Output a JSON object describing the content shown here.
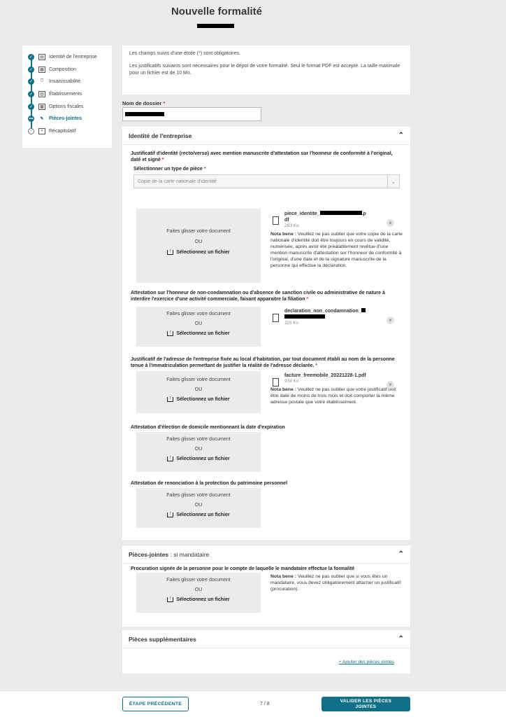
{
  "page": {
    "title": "Nouvelle formalité"
  },
  "stepper": {
    "steps": [
      {
        "label": "Identité de l'entreprise",
        "icon": "id-card-icon",
        "status": "done"
      },
      {
        "label": "Composition",
        "icon": "org-icon",
        "status": "done"
      },
      {
        "label": "Insaisissabilité",
        "icon": "shield-icon",
        "status": "done"
      },
      {
        "label": "Établissements",
        "icon": "building-icon",
        "status": "done"
      },
      {
        "label": "Options fiscales",
        "icon": "calculator-icon",
        "status": "done"
      },
      {
        "label": "Pièces-jointes",
        "icon": "paperclip-icon",
        "status": "active"
      },
      {
        "label": "Récapitulatif",
        "icon": "search-document-icon",
        "status": "todo"
      }
    ]
  },
  "info": {
    "line1_a": "Les champs suivis d'une étoile (",
    "line1_star": "*",
    "line1_b": ") sont obligatoires.",
    "line2": "Les justificatifs suivants sont nécessaires pour le dépot de votre formalité. Seul le format PDF est accepté. La taille maximale pour un fichier est de 10 Mo."
  },
  "dossier": {
    "label": "Nom de dossier",
    "star": "*"
  },
  "common": {
    "drag_text": "Faites glisser votre document",
    "or_text": "OU",
    "select_file": "Sélectionnez un fichier",
    "star": "*",
    "note_label": "Nota bene :"
  },
  "sections": {
    "identite": {
      "title": "Identité de l'entreprise",
      "field1": {
        "label": "Justificatif d'identité (recto/verso) avec mention manuscrite d'attestation sur l'honneur de conformité à l'original, daté et signé",
        "select_label": "Sélectionner un type de pièce",
        "select_value": "Copie de la carte nationale d'identité",
        "file_name_a": "piece_identite_",
        "file_name_b": ".p",
        "file_name_c": "df",
        "file_size": "283 Ko",
        "note": "Veuillez ne pas oublier que votre copie de la carte nationale d'identité doit être toujours en cours de validité, numérisée, après avoir été préalablement revêtue d'une mention manuscrite d'attestation sur l'honneur de conformité à l'original, d'une date et de la signature manuscrite de la personne qui effectue la déclaration."
      },
      "field2": {
        "label": "Attestation sur l'honneur de non-condamnation ou d'absence de sanction civile ou administrative de nature à interdire l'exercice d'une activité commerciale, faisant apparaitre la filiation",
        "file_name": "declaration_non_condamnation_",
        "file_size": "115 Ko"
      },
      "field3": {
        "label": "Justificatif de l'adresse de l'entreprise fixée au local d'habitation, par tout document établi au nom de la personne tenue à l'immatriculation permettant de justifier la réalité de l'adresse déclarée.",
        "file_name": "facture_freemobile_20221228-1.pdf",
        "file_size": "939 Ko",
        "note": "Veuillez ne pas oublier que votre justificatif doit être daté de moins de trois mois et doit comporter la même adresse postale que votre établissement."
      },
      "field4": {
        "label": "Attestation d'élection de domicile mentionnant la date d'expiration"
      },
      "field5": {
        "label": "Attestation de renonciation à la protection du patrimoine personnel"
      }
    },
    "mandataire": {
      "title": "Pièces-jointes",
      "subtitle": " : si mandataire",
      "field_label": "Procuration signée de la personne pour le compte de laquelle le mandataire effectue la formalité",
      "note": "Veuillez ne pas oublier que si vous êtes un mandataire, vous devez obligatoirement attacher un justificatif (procuration)."
    },
    "supplementaires": {
      "title": "Pièces supplémentaires",
      "add_link": "+ Ajouter des pièces jointes"
    }
  },
  "footer": {
    "prev_label": "ÉTAPE PRÉCÉDENTE",
    "pager": "7 / 8",
    "next_label": "VALIDER LES PIÈCES JOINTES"
  },
  "colors": {
    "accent": "#0f7088",
    "required": "#c0392b",
    "background": "#ebebeb"
  }
}
